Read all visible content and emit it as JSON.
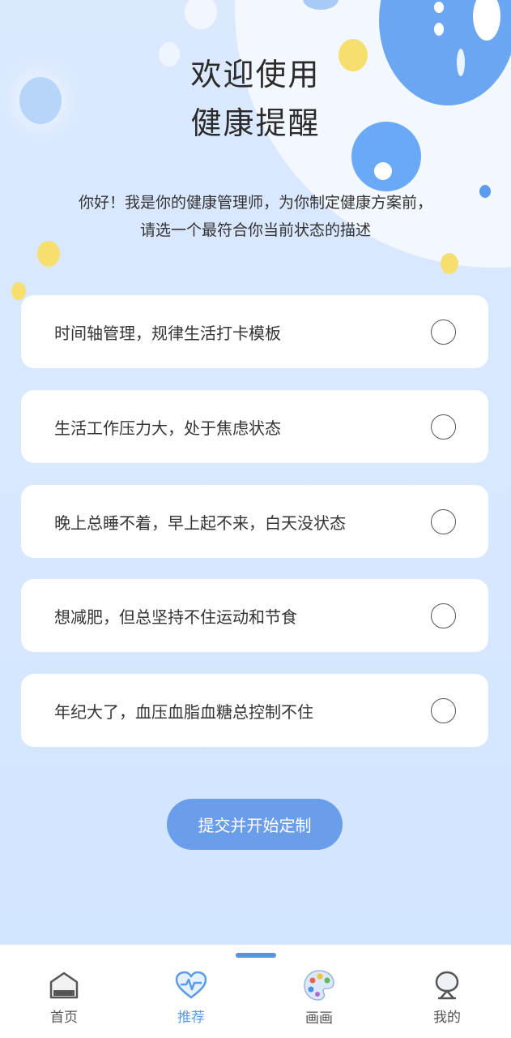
{
  "header": {
    "title_line1": "欢迎使用",
    "title_line2": "健康提醒",
    "intro_line1": "你好！我是你的健康管理师，为你制定健康方案前，",
    "intro_line2": "请选一个最符合你当前状态的描述"
  },
  "options": [
    {
      "label": "时间轴管理，规律生活打卡模板",
      "selected": false
    },
    {
      "label": "生活工作压力大，处于焦虑状态",
      "selected": false
    },
    {
      "label": "晚上总睡不着，早上起不来，白天没状态",
      "selected": false
    },
    {
      "label": "想减肥，但总坚持不住运动和节食",
      "selected": false
    },
    {
      "label": "年纪大了，血压血脂血糖总控制不住",
      "selected": false
    }
  ],
  "submit": {
    "label": "提交并开始定制"
  },
  "tabbar": {
    "tabs": [
      {
        "label": "首页",
        "icon": "home-icon",
        "active": false
      },
      {
        "label": "推荐",
        "icon": "heartbeat-icon",
        "active": true
      },
      {
        "label": "画画",
        "icon": "palette-icon",
        "active": false
      },
      {
        "label": "我的",
        "icon": "profile-icon",
        "active": false
      }
    ]
  },
  "colors": {
    "background": "#d6e7ff",
    "accent": "#6a9eea",
    "active_tab": "#5b9be8"
  }
}
